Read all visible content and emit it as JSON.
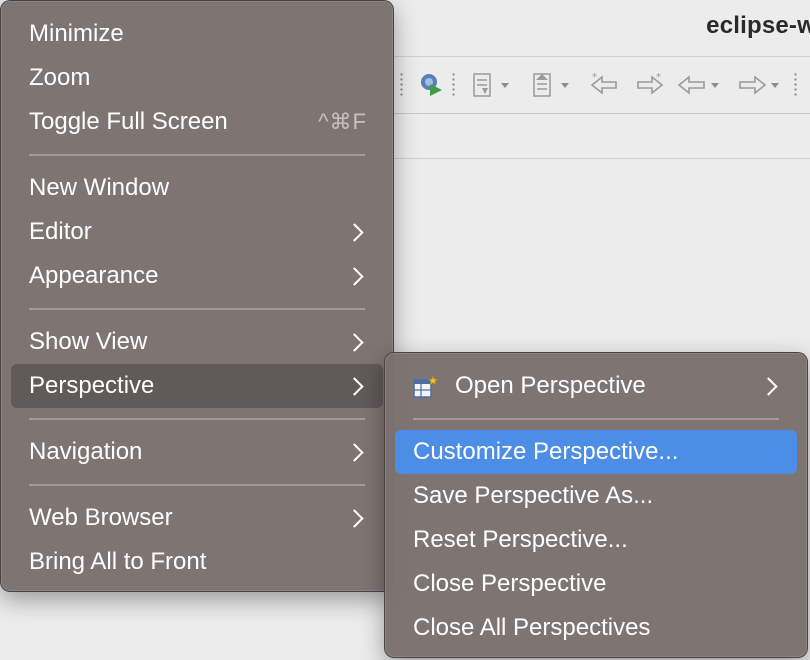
{
  "window": {
    "title": "eclipse-w"
  },
  "toolbar": {
    "icons": [
      "run-profile-icon",
      "next-annotation-icon",
      "prev-annotation-icon",
      "last-edit-location-icon",
      "forward-edit-icon",
      "back-icon",
      "forward-icon"
    ]
  },
  "window_menu": {
    "items": [
      {
        "label": "Minimize"
      },
      {
        "label": "Zoom"
      },
      {
        "label": "Toggle Full Screen",
        "shortcut": "^⌘F"
      },
      {
        "label": "New Window"
      },
      {
        "label": "Editor",
        "submenu": true
      },
      {
        "label": "Appearance",
        "submenu": true
      },
      {
        "label": "Show View",
        "submenu": true
      },
      {
        "label": "Perspective",
        "submenu": true,
        "highlighted": true
      },
      {
        "label": "Navigation",
        "submenu": true
      },
      {
        "label": "Web Browser",
        "submenu": true
      },
      {
        "label": "Bring All to Front"
      }
    ]
  },
  "perspective_submenu": {
    "items": [
      {
        "label": "Open Perspective",
        "icon": "open-perspective-icon",
        "submenu": true
      },
      {
        "label": "Customize Perspective...",
        "selected": true
      },
      {
        "label": "Save Perspective As..."
      },
      {
        "label": "Reset Perspective..."
      },
      {
        "label": "Close Perspective"
      },
      {
        "label": "Close All Perspectives"
      }
    ]
  },
  "colors": {
    "menu_bg": "#7a716e",
    "selection_blue": "#4c8ee6",
    "window_bg": "#ececec"
  }
}
